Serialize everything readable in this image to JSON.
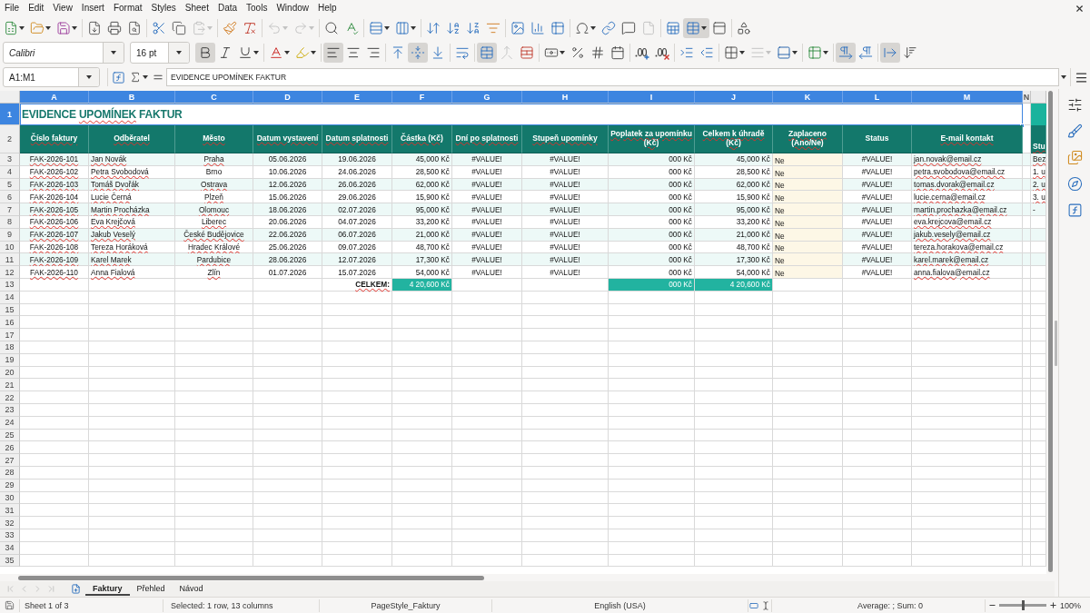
{
  "menu_bar": {
    "items": [
      "File",
      "Edit",
      "View",
      "Insert",
      "Format",
      "Styles",
      "Sheet",
      "Data",
      "Tools",
      "Window",
      "Help"
    ]
  },
  "standard_toolbar": {
    "buttons": [
      {
        "pressed": false,
        "disabled": false
      },
      {
        "pressed": false,
        "disabled": false
      },
      {
        "pressed": false,
        "disabled": false
      },
      {
        "pressed": false,
        "disabled": false
      },
      {
        "pressed": false,
        "disabled": false
      },
      {
        "pressed": false,
        "disabled": false
      },
      {
        "pressed": false,
        "disabled": false
      },
      {
        "pressed": false,
        "disabled": false
      },
      {
        "pressed": false,
        "disabled": true
      },
      {
        "pressed": false,
        "disabled": false
      },
      {
        "pressed": false,
        "disabled": false
      },
      {
        "pressed": false,
        "disabled": true
      },
      {
        "pressed": false,
        "disabled": true
      },
      {
        "pressed": false,
        "disabled": false
      },
      {
        "pressed": false,
        "disabled": false
      },
      {
        "pressed": false,
        "disabled": false
      },
      {
        "pressed": false,
        "disabled": false
      },
      {
        "pressed": false,
        "disabled": false
      },
      {
        "pressed": false,
        "disabled": false
      },
      {
        "pressed": false,
        "disabled": false
      },
      {
        "pressed": false,
        "disabled": false
      },
      {
        "pressed": false,
        "disabled": false
      },
      {
        "pressed": false,
        "disabled": false
      },
      {
        "pressed": false,
        "disabled": false
      },
      {
        "pressed": false,
        "disabled": false
      },
      {
        "pressed": false,
        "disabled": false
      },
      {
        "pressed": false,
        "disabled": false
      },
      {
        "pressed": false,
        "disabled": true
      },
      {
        "pressed": false,
        "disabled": false
      },
      {
        "pressed": true,
        "disabled": false
      },
      {
        "pressed": false,
        "disabled": false
      },
      {
        "pressed": false,
        "disabled": false
      }
    ]
  },
  "formatting_toolbar": {
    "font_name": "Calibri",
    "font_size": "16 pt",
    "buttons": [
      {
        "pressed": true,
        "disabled": false
      },
      {
        "pressed": false,
        "disabled": false
      },
      {
        "pressed": false,
        "disabled": false
      },
      {
        "pressed": false,
        "disabled": false
      },
      {
        "pressed": false,
        "disabled": false
      },
      {
        "pressed": true,
        "disabled": false
      },
      {
        "pressed": false,
        "disabled": false
      },
      {
        "pressed": false,
        "disabled": false
      },
      {
        "pressed": false,
        "disabled": false
      },
      {
        "pressed": true,
        "disabled": false
      },
      {
        "pressed": false,
        "disabled": false
      },
      {
        "pressed": false,
        "disabled": false
      },
      {
        "pressed": true,
        "disabled": false
      },
      {
        "pressed": false,
        "disabled": true
      },
      {
        "pressed": false,
        "disabled": false
      },
      {
        "pressed": false,
        "disabled": false
      },
      {
        "pressed": false,
        "disabled": false
      },
      {
        "pressed": false,
        "disabled": false
      },
      {
        "pressed": false,
        "disabled": false
      },
      {
        "pressed": false,
        "disabled": false
      },
      {
        "pressed": false,
        "disabled": false
      },
      {
        "pressed": false,
        "disabled": false
      },
      {
        "pressed": false,
        "disabled": false
      },
      {
        "pressed": false,
        "disabled": false
      },
      {
        "pressed": false,
        "disabled": true
      },
      {
        "pressed": false,
        "disabled": false
      },
      {
        "pressed": false,
        "disabled": false
      },
      {
        "pressed": true,
        "disabled": false
      },
      {
        "pressed": false,
        "disabled": false
      },
      {
        "pressed": true,
        "disabled": false
      },
      {
        "pressed": false,
        "disabled": false
      }
    ]
  },
  "formula_bar": {
    "name_box": "A1:M1",
    "content": "EVIDENCE UPOMÍNEK FAKTUR"
  },
  "sheet": {
    "columns": [
      {
        "label": "A",
        "selected": true
      },
      {
        "label": "B",
        "selected": true
      },
      {
        "label": "C",
        "selected": true
      },
      {
        "label": "D",
        "selected": true
      },
      {
        "label": "E",
        "selected": true
      },
      {
        "label": "F",
        "selected": true
      },
      {
        "label": "G",
        "selected": true
      },
      {
        "label": "H",
        "selected": true
      },
      {
        "label": "I",
        "selected": true
      },
      {
        "label": "J",
        "selected": true
      },
      {
        "label": "K",
        "selected": true
      },
      {
        "label": "L",
        "selected": true
      },
      {
        "label": "M",
        "selected": true
      },
      {
        "label": "N",
        "selected": false
      }
    ],
    "rows": [
      {
        "kind": "title",
        "number": "1",
        "selected": true,
        "segments": [
          {
            "text": "EVIDENCE ",
            "misspelled": false
          },
          {
            "text": "UPOMÍNEK",
            "misspelled": true
          },
          {
            "text": " FAKTUR",
            "misspelled": false
          }
        ]
      },
      {
        "kind": "header",
        "number": "2",
        "selected": false,
        "cells": [
          {
            "text": "Číslo faktury",
            "misspelled": true
          },
          {
            "text": "Odběratel",
            "misspelled": true
          },
          {
            "text": "Město",
            "misspelled": true
          },
          {
            "text": "Datum vystavení",
            "misspelled": true
          },
          {
            "text": "Datum splatnosti",
            "misspelled": true
          },
          {
            "text": "Částka (Kč)",
            "misspelled": true
          },
          {
            "text": "Dní po splatnosti",
            "misspelled": true
          },
          {
            "text": "Stupeň upomínky",
            "misspelled": true
          },
          {
            "text": "Poplatek za upomínku (Kč)",
            "misspelled": true
          },
          {
            "text": "Celkem k úhradě (Kč)",
            "misspelled": true
          },
          {
            "text": "Zaplaceno (Ano/Ne)",
            "misspelled": true
          },
          {
            "text": "Status",
            "misspelled": false
          },
          {
            "text": "E-mail kontakt",
            "misspelled": true
          }
        ],
        "cut_off_cell": {
          "text": "Stu",
          "misspelled": true
        }
      },
      {
        "kind": "data",
        "number": "3",
        "selected": false,
        "shaded": true,
        "cells": [
          {
            "text": "FAK-2026-101",
            "misspelled": true
          },
          {
            "text": "Jan Novák",
            "misspelled": true
          },
          {
            "text": "Praha",
            "misspelled": true
          },
          {
            "text": "05.06.2026",
            "misspelled": false
          },
          {
            "text": "19.06.2026",
            "misspelled": false
          },
          {
            "text": "45,000 Kč",
            "misspelled": false
          },
          {
            "text": "#VALUE!",
            "misspelled": false
          },
          {
            "text": "#VALUE!",
            "misspelled": false
          },
          {
            "text": "000 Kč",
            "misspelled": false
          },
          {
            "text": "45,000 Kč",
            "misspelled": false
          },
          {
            "text": "Ne",
            "misspelled": false
          },
          {
            "text": "#VALUE!",
            "misspelled": false
          },
          {
            "text": "jan.novak@email.cz",
            "misspelled": true
          }
        ],
        "cut_off_cell": {
          "text": "Bez",
          "misspelled": true
        }
      },
      {
        "kind": "data",
        "number": "4",
        "selected": false,
        "shaded": false,
        "cells": [
          {
            "text": "FAK-2026-102",
            "misspelled": true
          },
          {
            "text": "Petra Svobodová",
            "misspelled": true
          },
          {
            "text": "Brno",
            "misspelled": false
          },
          {
            "text": "10.06.2026",
            "misspelled": false
          },
          {
            "text": "24.06.2026",
            "misspelled": false
          },
          {
            "text": "28,500 Kč",
            "misspelled": false
          },
          {
            "text": "#VALUE!",
            "misspelled": false
          },
          {
            "text": "#VALUE!",
            "misspelled": false
          },
          {
            "text": "000 Kč",
            "misspelled": false
          },
          {
            "text": "28,500 Kč",
            "misspelled": false
          },
          {
            "text": "Ne",
            "misspelled": false
          },
          {
            "text": "#VALUE!",
            "misspelled": false
          },
          {
            "text": "petra.svobodova@email.cz",
            "misspelled": true
          }
        ],
        "cut_off_cell": {
          "text": "1. u",
          "misspelled": true
        }
      },
      {
        "kind": "data",
        "number": "5",
        "selected": false,
        "shaded": true,
        "cells": [
          {
            "text": "FAK-2026-103",
            "misspelled": true
          },
          {
            "text": "Tomáš Dvořák",
            "misspelled": true
          },
          {
            "text": "Ostrava",
            "misspelled": true
          },
          {
            "text": "12.06.2026",
            "misspelled": false
          },
          {
            "text": "26.06.2026",
            "misspelled": false
          },
          {
            "text": "62,000 Kč",
            "misspelled": false
          },
          {
            "text": "#VALUE!",
            "misspelled": false
          },
          {
            "text": "#VALUE!",
            "misspelled": false
          },
          {
            "text": "000 Kč",
            "misspelled": false
          },
          {
            "text": "62,000 Kč",
            "misspelled": false
          },
          {
            "text": "Ne",
            "misspelled": false
          },
          {
            "text": "#VALUE!",
            "misspelled": false
          },
          {
            "text": "tomas.dvorak@email.cz",
            "misspelled": true
          }
        ],
        "cut_off_cell": {
          "text": "2. u",
          "misspelled": true
        }
      },
      {
        "kind": "data",
        "number": "6",
        "selected": false,
        "shaded": false,
        "cells": [
          {
            "text": "FAK-2026-104",
            "misspelled": true
          },
          {
            "text": "Lucie Černá",
            "misspelled": true
          },
          {
            "text": "Plzeň",
            "misspelled": true
          },
          {
            "text": "15.06.2026",
            "misspelled": false
          },
          {
            "text": "29.06.2026",
            "misspelled": false
          },
          {
            "text": "15,900 Kč",
            "misspelled": false
          },
          {
            "text": "#VALUE!",
            "misspelled": false
          },
          {
            "text": "#VALUE!",
            "misspelled": false
          },
          {
            "text": "000 Kč",
            "misspelled": false
          },
          {
            "text": "15,900 Kč",
            "misspelled": false
          },
          {
            "text": "Ne",
            "misspelled": false
          },
          {
            "text": "#VALUE!",
            "misspelled": false
          },
          {
            "text": "lucie.cerna@email.cz",
            "misspelled": true
          }
        ],
        "cut_off_cell": {
          "text": "3. u",
          "misspelled": true
        }
      },
      {
        "kind": "data",
        "number": "7",
        "selected": false,
        "shaded": true,
        "cells": [
          {
            "text": "FAK-2026-105",
            "misspelled": true
          },
          {
            "text": "Martin Procházka",
            "misspelled": true
          },
          {
            "text": "Olomouc",
            "misspelled": true
          },
          {
            "text": "18.06.2026",
            "misspelled": false
          },
          {
            "text": "02.07.2026",
            "misspelled": false
          },
          {
            "text": "95,000 Kč",
            "misspelled": false
          },
          {
            "text": "#VALUE!",
            "misspelled": false
          },
          {
            "text": "#VALUE!",
            "misspelled": false
          },
          {
            "text": "000 Kč",
            "misspelled": false
          },
          {
            "text": "95,000 Kč",
            "misspelled": false
          },
          {
            "text": "Ne",
            "misspelled": false
          },
          {
            "text": "#VALUE!",
            "misspelled": false
          },
          {
            "text": "martin.prochazka@email.cz",
            "misspelled": true
          }
        ],
        "cut_off_cell": {
          "text": "-"
        }
      },
      {
        "kind": "data",
        "number": "8",
        "selected": false,
        "shaded": false,
        "cells": [
          {
            "text": "FAK-2026-106",
            "misspelled": true
          },
          {
            "text": "Eva Krejčová",
            "misspelled": true
          },
          {
            "text": "Liberec",
            "misspelled": true
          },
          {
            "text": "20.06.2026",
            "misspelled": false
          },
          {
            "text": "04.07.2026",
            "misspelled": false
          },
          {
            "text": "33,200 Kč",
            "misspelled": false
          },
          {
            "text": "#VALUE!",
            "misspelled": false
          },
          {
            "text": "#VALUE!",
            "misspelled": false
          },
          {
            "text": "000 Kč",
            "misspelled": false
          },
          {
            "text": "33,200 Kč",
            "misspelled": false
          },
          {
            "text": "Ne",
            "misspelled": false
          },
          {
            "text": "#VALUE!",
            "misspelled": false
          },
          {
            "text": "eva.krejcova@email.cz",
            "misspelled": true
          }
        ]
      },
      {
        "kind": "data",
        "number": "9",
        "selected": false,
        "shaded": true,
        "cells": [
          {
            "text": "FAK-2026-107",
            "misspelled": true
          },
          {
            "text": "Jakub Veselý",
            "misspelled": true
          },
          {
            "text": "České Budějovice",
            "misspelled": true
          },
          {
            "text": "22.06.2026",
            "misspelled": false
          },
          {
            "text": "06.07.2026",
            "misspelled": false
          },
          {
            "text": "21,000 Kč",
            "misspelled": false
          },
          {
            "text": "#VALUE!",
            "misspelled": false
          },
          {
            "text": "#VALUE!",
            "misspelled": false
          },
          {
            "text": "000 Kč",
            "misspelled": false
          },
          {
            "text": "21,000 Kč",
            "misspelled": false
          },
          {
            "text": "Ne",
            "misspelled": false
          },
          {
            "text": "#VALUE!",
            "misspelled": false
          },
          {
            "text": "jakub.vesely@email.cz",
            "misspelled": true
          }
        ]
      },
      {
        "kind": "data",
        "number": "10",
        "selected": false,
        "shaded": false,
        "cells": [
          {
            "text": "FAK-2026-108",
            "misspelled": true
          },
          {
            "text": "Tereza Horáková",
            "misspelled": true
          },
          {
            "text": "Hradec Králové",
            "misspelled": true
          },
          {
            "text": "25.06.2026",
            "misspelled": false
          },
          {
            "text": "09.07.2026",
            "misspelled": false
          },
          {
            "text": "48,700 Kč",
            "misspelled": false
          },
          {
            "text": "#VALUE!",
            "misspelled": false
          },
          {
            "text": "#VALUE!",
            "misspelled": false
          },
          {
            "text": "000 Kč",
            "misspelled": false
          },
          {
            "text": "48,700 Kč",
            "misspelled": false
          },
          {
            "text": "Ne",
            "misspelled": false
          },
          {
            "text": "#VALUE!",
            "misspelled": false
          },
          {
            "text": "tereza.horakova@email.cz",
            "misspelled": true
          }
        ]
      },
      {
        "kind": "data",
        "number": "11",
        "selected": false,
        "shaded": true,
        "cells": [
          {
            "text": "FAK-2026-109",
            "misspelled": true
          },
          {
            "text": "Karel Marek",
            "misspelled": true
          },
          {
            "text": "Pardubice",
            "misspelled": true
          },
          {
            "text": "28.06.2026",
            "misspelled": false
          },
          {
            "text": "12.07.2026",
            "misspelled": false
          },
          {
            "text": "17,300 Kč",
            "misspelled": false
          },
          {
            "text": "#VALUE!",
            "misspelled": false
          },
          {
            "text": "#VALUE!",
            "misspelled": false
          },
          {
            "text": "000 Kč",
            "misspelled": false
          },
          {
            "text": "17,300 Kč",
            "misspelled": false
          },
          {
            "text": "Ne",
            "misspelled": false
          },
          {
            "text": "#VALUE!",
            "misspelled": false
          },
          {
            "text": "karel.marek@email.cz",
            "misspelled": true
          }
        ]
      },
      {
        "kind": "data",
        "number": "12",
        "selected": false,
        "shaded": false,
        "cells": [
          {
            "text": "FAK-2026-110",
            "misspelled": true
          },
          {
            "text": "Anna Fialová",
            "misspelled": true
          },
          {
            "text": "Zlín",
            "misspelled": true
          },
          {
            "text": "01.07.2026",
            "misspelled": false
          },
          {
            "text": "15.07.2026",
            "misspelled": false
          },
          {
            "text": "54,000 Kč",
            "misspelled": false
          },
          {
            "text": "#VALUE!",
            "misspelled": false
          },
          {
            "text": "#VALUE!",
            "misspelled": false
          },
          {
            "text": "000 Kč",
            "misspelled": false
          },
          {
            "text": "54,000 Kč",
            "misspelled": false
          },
          {
            "text": "Ne",
            "misspelled": false
          },
          {
            "text": "#VALUE!",
            "misspelled": false
          },
          {
            "text": "anna.fialova@email.cz",
            "misspelled": true
          }
        ]
      },
      {
        "kind": "totals",
        "number": "13",
        "selected": false,
        "cells": [
          {
            "kind": "blank"
          },
          {
            "kind": "blank"
          },
          {
            "kind": "blank"
          },
          {
            "kind": "blank"
          },
          {
            "kind": "label",
            "text": "CELKEM:",
            "misspelled": true
          },
          {
            "kind": "total",
            "text": "4 20,600 Kč",
            "misspelled": false
          },
          {
            "kind": "blank"
          },
          {
            "kind": "blank"
          },
          {
            "kind": "total",
            "text": "000 Kč",
            "misspelled": false
          },
          {
            "kind": "total",
            "text": "4 20,600 Kč",
            "misspelled": false
          },
          {
            "kind": "blank"
          },
          {
            "kind": "blank"
          },
          {
            "kind": "blank"
          }
        ]
      },
      {
        "kind": "empty",
        "number": "14",
        "selected": false
      },
      {
        "kind": "empty",
        "number": "15",
        "selected": false
      },
      {
        "kind": "empty",
        "number": "16",
        "selected": false
      },
      {
        "kind": "empty",
        "number": "17",
        "selected": false
      },
      {
        "kind": "empty",
        "number": "18",
        "selected": false
      },
      {
        "kind": "empty",
        "number": "19",
        "selected": false
      },
      {
        "kind": "empty",
        "number": "20",
        "selected": false
      },
      {
        "kind": "empty",
        "number": "21",
        "selected": false
      },
      {
        "kind": "empty",
        "number": "22",
        "selected": false
      },
      {
        "kind": "empty",
        "number": "23",
        "selected": false
      },
      {
        "kind": "empty",
        "number": "24",
        "selected": false
      },
      {
        "kind": "empty",
        "number": "25",
        "selected": false
      },
      {
        "kind": "empty",
        "number": "26",
        "selected": false
      },
      {
        "kind": "empty",
        "number": "27",
        "selected": false
      },
      {
        "kind": "empty",
        "number": "28",
        "selected": false
      },
      {
        "kind": "empty",
        "number": "29",
        "selected": false
      },
      {
        "kind": "empty",
        "number": "30",
        "selected": false
      },
      {
        "kind": "empty",
        "number": "31",
        "selected": false
      },
      {
        "kind": "empty",
        "number": "32",
        "selected": false
      },
      {
        "kind": "empty",
        "number": "33",
        "selected": false
      },
      {
        "kind": "empty",
        "number": "34",
        "selected": false
      },
      {
        "kind": "empty",
        "number": "35",
        "selected": false
      }
    ]
  },
  "sheet_navigation": [
    {
      "disabled": true
    },
    {
      "disabled": true
    },
    {
      "disabled": true
    },
    {
      "disabled": true
    }
  ],
  "sheet_tabs": [
    {
      "label": "Faktury",
      "selected": true
    },
    {
      "label": "Přehled",
      "selected": false
    },
    {
      "label": "Návod",
      "selected": false
    }
  ],
  "status_bar": {
    "sheet_count": "Sheet 1 of 3",
    "selection": "Selected: 1 row, 13 columns",
    "page_style": "PageStyle_Faktury",
    "language": "English (USA)",
    "summary": "Average: ; Sum: 0",
    "zoom": {
      "level": 0.5,
      "reading": "100%"
    }
  }
}
